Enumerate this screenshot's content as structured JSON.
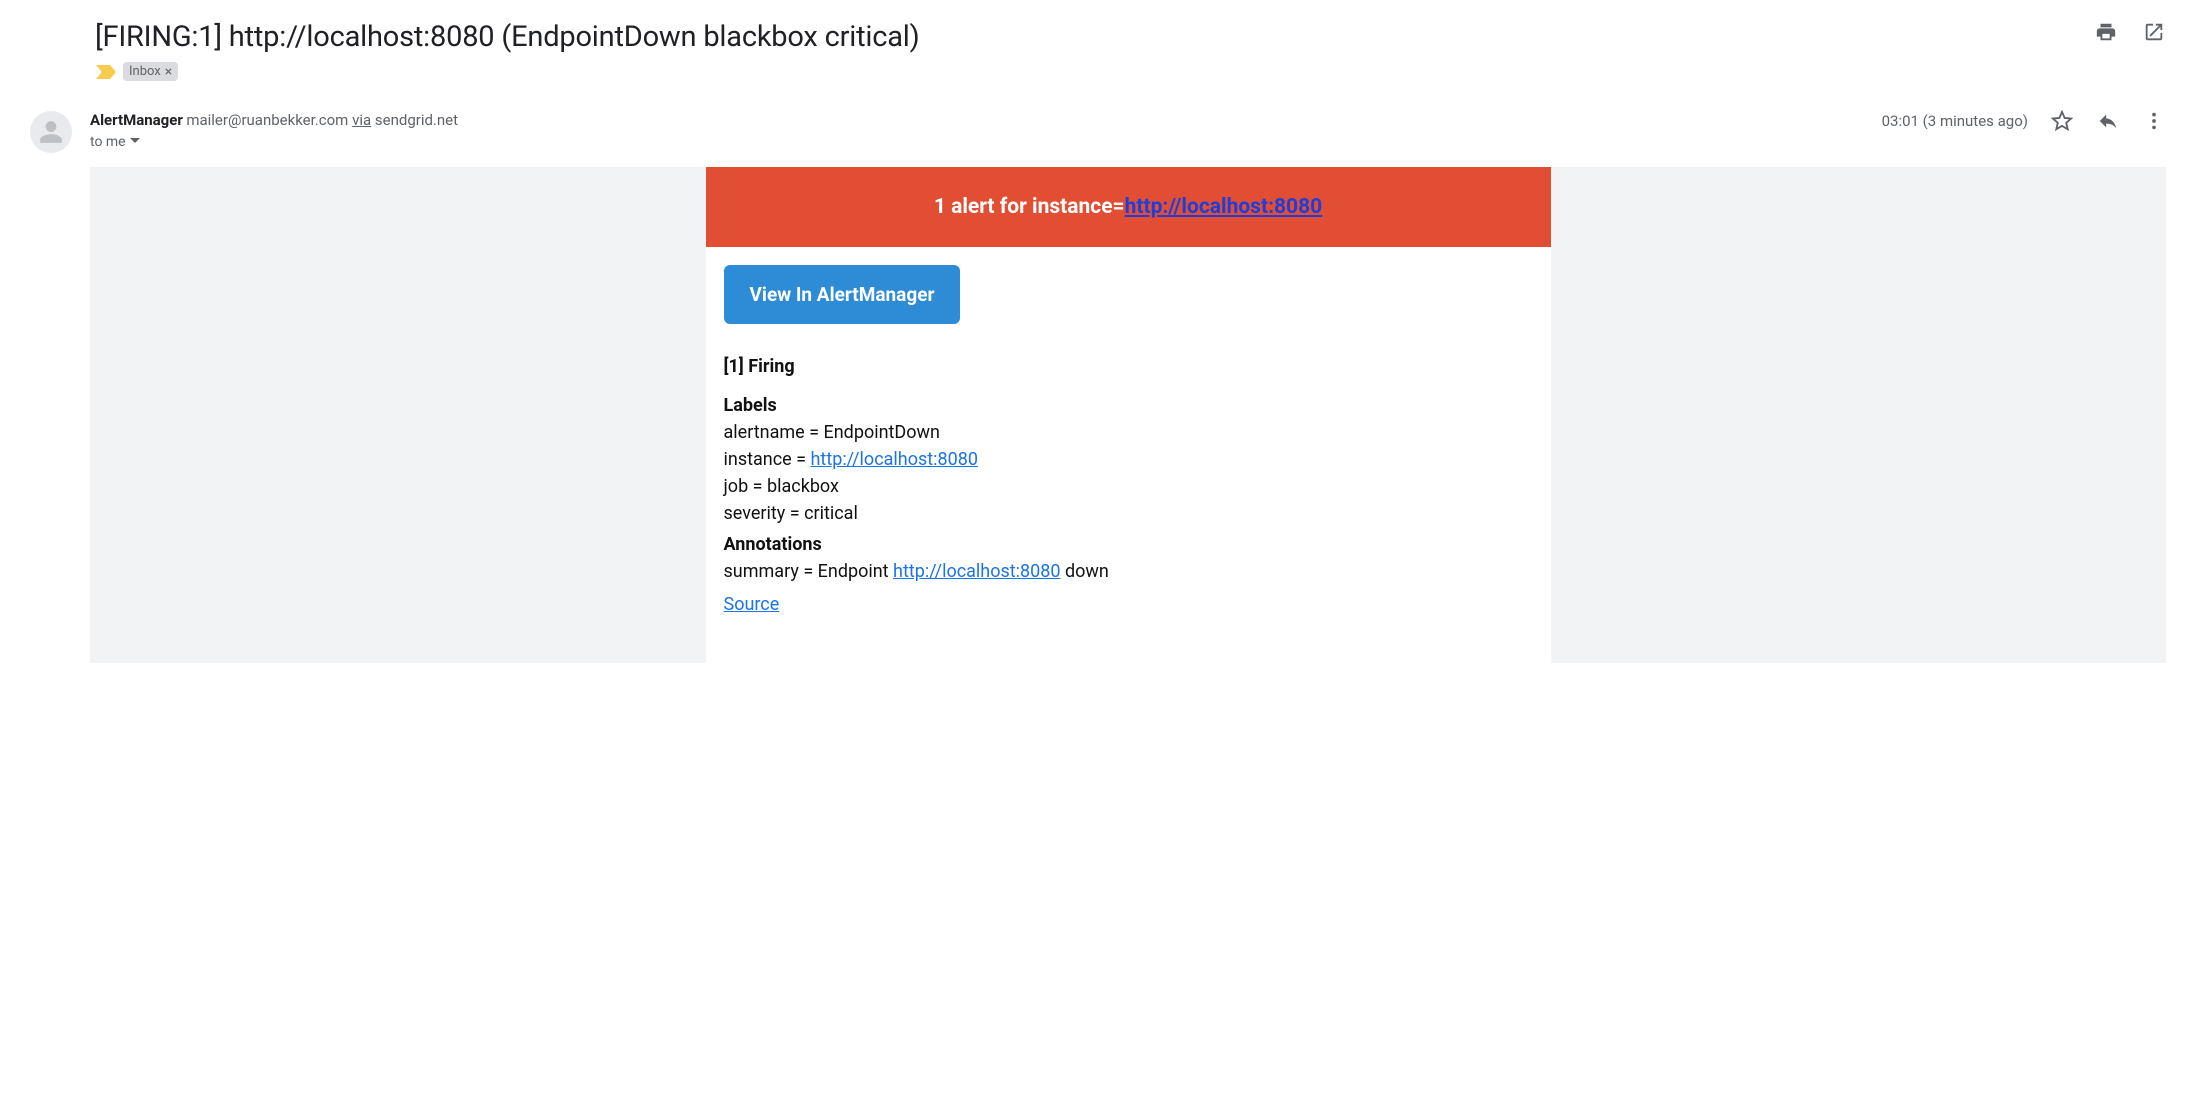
{
  "subject": "[FIRING:1] http://localhost:8080 (EndpointDown blackbox critical)",
  "inbox_chip": "Inbox",
  "sender": {
    "name": "AlertManager",
    "email": "mailer@ruanbekker.com",
    "via_word": "via",
    "via_domain": "sendgrid.net",
    "to_line": "to me"
  },
  "meta": {
    "time": "03:01 (3 minutes ago)"
  },
  "alert": {
    "header_prefix": "1 alert for instance=",
    "header_link": "http://localhost:8080",
    "view_btn": "View In AlertManager",
    "firing_heading": "[1] Firing",
    "labels_heading": "Labels",
    "labels": {
      "alertname": {
        "key": "alertname = ",
        "value": "EndpointDown"
      },
      "instance": {
        "key": "instance = ",
        "link": "http://localhost:8080"
      },
      "job": {
        "key": "job = ",
        "value": "blackbox"
      },
      "severity": {
        "key": "severity = ",
        "value": "critical"
      }
    },
    "annotations_heading": "Annotations",
    "annotations": {
      "summary": {
        "key": "summary = Endpoint ",
        "link": "http://localhost:8080",
        "suffix": " down"
      }
    },
    "source_link": "Source"
  }
}
